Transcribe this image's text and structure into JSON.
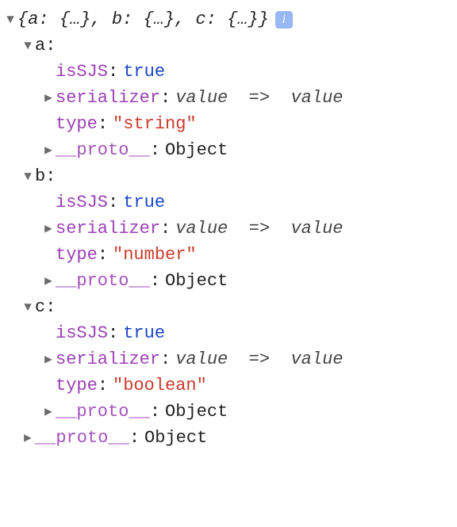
{
  "root": {
    "summary_prefix": "{",
    "summary_a_key": "a",
    "summary_a_val": "{…}",
    "summary_b_key": "b",
    "summary_b_val": "{…}",
    "summary_c_key": "c",
    "summary_c_val": "{…}",
    "summary_suffix": "}",
    "info_glyph": "i"
  },
  "entries": {
    "a": {
      "key": "a",
      "isSJS_key": "isSJS",
      "isSJS_val": "true",
      "serializer_key": "serializer",
      "serializer_val_lhs": "value",
      "serializer_val_arrow": "=>",
      "serializer_val_rhs": "value",
      "type_key": "type",
      "type_val": "\"string\"",
      "proto_key": "__proto__",
      "proto_val": "Object"
    },
    "b": {
      "key": "b",
      "isSJS_key": "isSJS",
      "isSJS_val": "true",
      "serializer_key": "serializer",
      "serializer_val_lhs": "value",
      "serializer_val_arrow": "=>",
      "serializer_val_rhs": "value",
      "type_key": "type",
      "type_val": "\"number\"",
      "proto_key": "__proto__",
      "proto_val": "Object"
    },
    "c": {
      "key": "c",
      "isSJS_key": "isSJS",
      "isSJS_val": "true",
      "serializer_key": "serializer",
      "serializer_val_lhs": "value",
      "serializer_val_arrow": "=>",
      "serializer_val_rhs": "value",
      "type_key": "type",
      "type_val": "\"boolean\"",
      "proto_key": "__proto__",
      "proto_val": "Object"
    }
  },
  "root_proto": {
    "proto_key": "__proto__",
    "proto_val": "Object"
  }
}
